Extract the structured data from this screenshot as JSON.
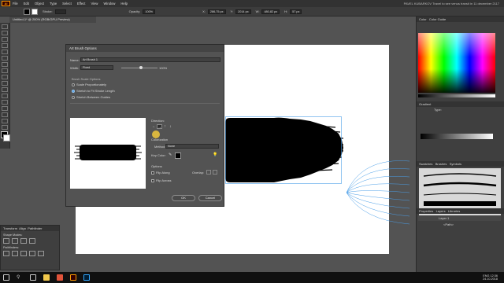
{
  "app": {
    "logo": "Ai"
  },
  "menu": {
    "items": [
      "File",
      "Edit",
      "Object",
      "Type",
      "Select",
      "Effect",
      "View",
      "Window",
      "Help"
    ],
    "right_text": "PAVEL KUBARKOV  Travel to see venus transit in 11 december 2117"
  },
  "control_bar": {
    "stroke_label": "Stroke:",
    "opacity_label": "Opacity:",
    "opacity_value": "100%",
    "x_label": "X:",
    "x_value": "286,75 px",
    "y_label": "Y:",
    "y_value": "2014 px",
    "w_label": "W:",
    "w_value": "480,82 px",
    "h_label": "H:",
    "h_value": "57 px"
  },
  "document_tab": {
    "title": "Untitled-1* @ 200% (RGB/GPU Preview)"
  },
  "dialog": {
    "title": "Art Brush Options",
    "name_label": "Name:",
    "name_value": "Art Brush 1",
    "width_label": "Width:",
    "width_value": "Fixed",
    "width_percent": "100%",
    "scale_section": "Brush Scale Options",
    "scale_options": [
      {
        "label": "Scale Proportionately",
        "selected": false
      },
      {
        "label": "Stretch to Fit Stroke Length",
        "selected": true
      },
      {
        "label": "Stretch Between Guides",
        "selected": false
      }
    ],
    "direction_label": "Direction:",
    "colorization_label": "Colorization",
    "method_label": "Method:",
    "method_value": "None",
    "key_color_label": "Key Color:",
    "options_label": "Options",
    "flip_along_label": "Flip Along",
    "flip_across_label": "Flip Across",
    "overlap_label": "Overlap:",
    "ok_label": "OK",
    "cancel_label": "Cancel"
  },
  "right_panels": {
    "color_tabs": [
      "Color",
      "Color Guide"
    ],
    "gradient_tab": "Gradient",
    "gradient_type_label": "Type:",
    "brush_tabs": [
      "Swatches",
      "Brushes",
      "Symbols"
    ],
    "layers_tabs": [
      "Properties",
      "Layers",
      "Libraries"
    ],
    "layer_items": [
      "Layer 1",
      "<Path>"
    ]
  },
  "left_panels": {
    "tabs": [
      "Transform",
      "Align",
      "Pathfinder"
    ],
    "shape_modes_label": "Shape Modes:",
    "pathfinders_label": "Pathfinders:"
  },
  "taskbar": {
    "language": "ENG",
    "time": "12:36",
    "date": "24.10.2018"
  },
  "colors": {
    "accent": "#4a9ee8",
    "ui_dark": "#3f3f3f",
    "canvas_bg": "#535353",
    "ai_orange": "#ff9a00"
  }
}
